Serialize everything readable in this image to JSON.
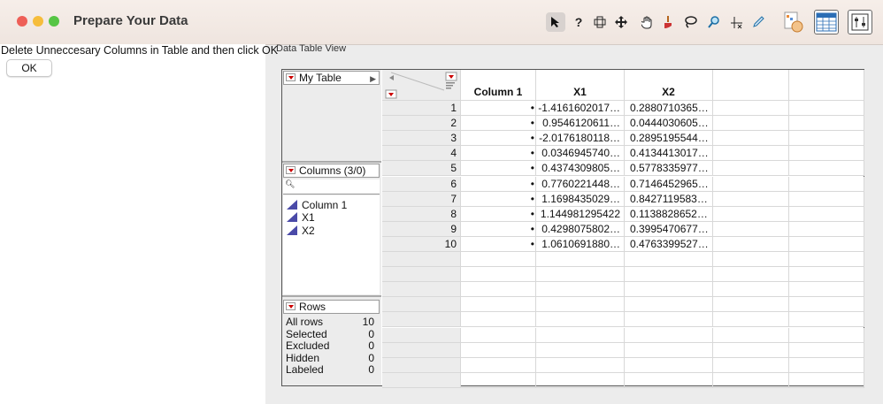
{
  "window": {
    "title": "Prepare Your Data",
    "traffic_lights": [
      "#ee5f57",
      "#f6bd3b",
      "#56c544"
    ]
  },
  "toolbar": {
    "icons": [
      "arrow-cursor-icon",
      "question-help-icon",
      "crosshair-icon",
      "move-icon",
      "hand-icon",
      "brush-icon",
      "lasso-icon",
      "magnifier-icon",
      "scaler-icon",
      "pencil-icon",
      "table-chart-icon",
      "data-table-icon",
      "control-panel-icon"
    ]
  },
  "left_panel": {
    "instruction": "Delete Unneccesary Columns in Table and then click OK",
    "ok_label": "OK"
  },
  "data_table": {
    "section_label": "Data Table View",
    "table_name": "My Table",
    "columns_header": "Columns (3/0)",
    "columns": [
      "Column 1",
      "X1",
      "X2"
    ],
    "rows_header": "Rows",
    "row_stats": [
      {
        "label": "All rows",
        "value": "10"
      },
      {
        "label": "Selected",
        "value": "0"
      },
      {
        "label": "Excluded",
        "value": "0"
      },
      {
        "label": "Hidden",
        "value": "0"
      },
      {
        "label": "Labeled",
        "value": "0"
      }
    ],
    "rows": [
      {
        "n": "1",
        "c1": "•",
        "x1": "-1.4161602017…",
        "x2": "0.2880710365…"
      },
      {
        "n": "2",
        "c1": "•",
        "x1": "0.9546120611…",
        "x2": "0.0444030605…"
      },
      {
        "n": "3",
        "c1": "•",
        "x1": "-2.0176180118…",
        "x2": "0.2895195544…"
      },
      {
        "n": "4",
        "c1": "•",
        "x1": "0.0346945740…",
        "x2": "0.4134413017…"
      },
      {
        "n": "5",
        "c1": "•",
        "x1": "0.4374309805…",
        "x2": "0.5778335977…"
      },
      {
        "n": "6",
        "c1": "•",
        "x1": "0.7760221448…",
        "x2": "0.7146452965…"
      },
      {
        "n": "7",
        "c1": "•",
        "x1": "1.1698435029…",
        "x2": "0.8427119583…"
      },
      {
        "n": "8",
        "c1": "•",
        "x1": "1.144981295422",
        "x2": "0.1138828652…"
      },
      {
        "n": "9",
        "c1": "•",
        "x1": "0.4298075802…",
        "x2": "0.3995470677…"
      },
      {
        "n": "10",
        "c1": "•",
        "x1": "1.0610691880…",
        "x2": "0.4763399527…"
      }
    ]
  }
}
